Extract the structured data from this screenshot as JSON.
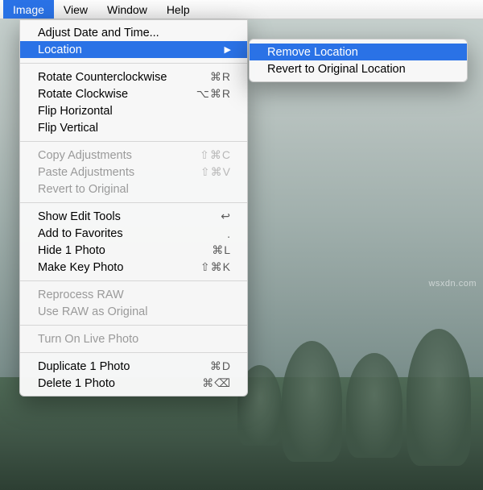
{
  "menubar": {
    "image": "Image",
    "view": "View",
    "window": "Window",
    "help": "Help"
  },
  "menu": {
    "adjust_date_time": "Adjust Date and Time...",
    "location": "Location",
    "rotate_ccw": {
      "label": "Rotate Counterclockwise",
      "sc": "⌘R"
    },
    "rotate_cw": {
      "label": "Rotate Clockwise",
      "sc": "⌥⌘R"
    },
    "flip_h": "Flip Horizontal",
    "flip_v": "Flip Vertical",
    "copy_adj": {
      "label": "Copy Adjustments",
      "sc": "⇧⌘C"
    },
    "paste_adj": {
      "label": "Paste Adjustments",
      "sc": "⇧⌘V"
    },
    "revert_orig": "Revert to Original",
    "show_edit": {
      "label": "Show Edit Tools",
      "sc": "↩"
    },
    "add_fav": {
      "label": "Add to Favorites",
      "sc": "."
    },
    "hide_photo": {
      "label": "Hide 1 Photo",
      "sc": "⌘L"
    },
    "make_key": {
      "label": "Make Key Photo",
      "sc": "⇧⌘K"
    },
    "reprocess": "Reprocess RAW",
    "use_raw": "Use RAW as Original",
    "live_photo": "Turn On Live Photo",
    "duplicate": {
      "label": "Duplicate 1 Photo",
      "sc": "⌘D"
    },
    "delete": {
      "label": "Delete 1 Photo",
      "sc": "⌘⌫"
    }
  },
  "submenu": {
    "remove": "Remove Location",
    "revert": "Revert to Original Location"
  },
  "watermark": "wsxdn.com"
}
